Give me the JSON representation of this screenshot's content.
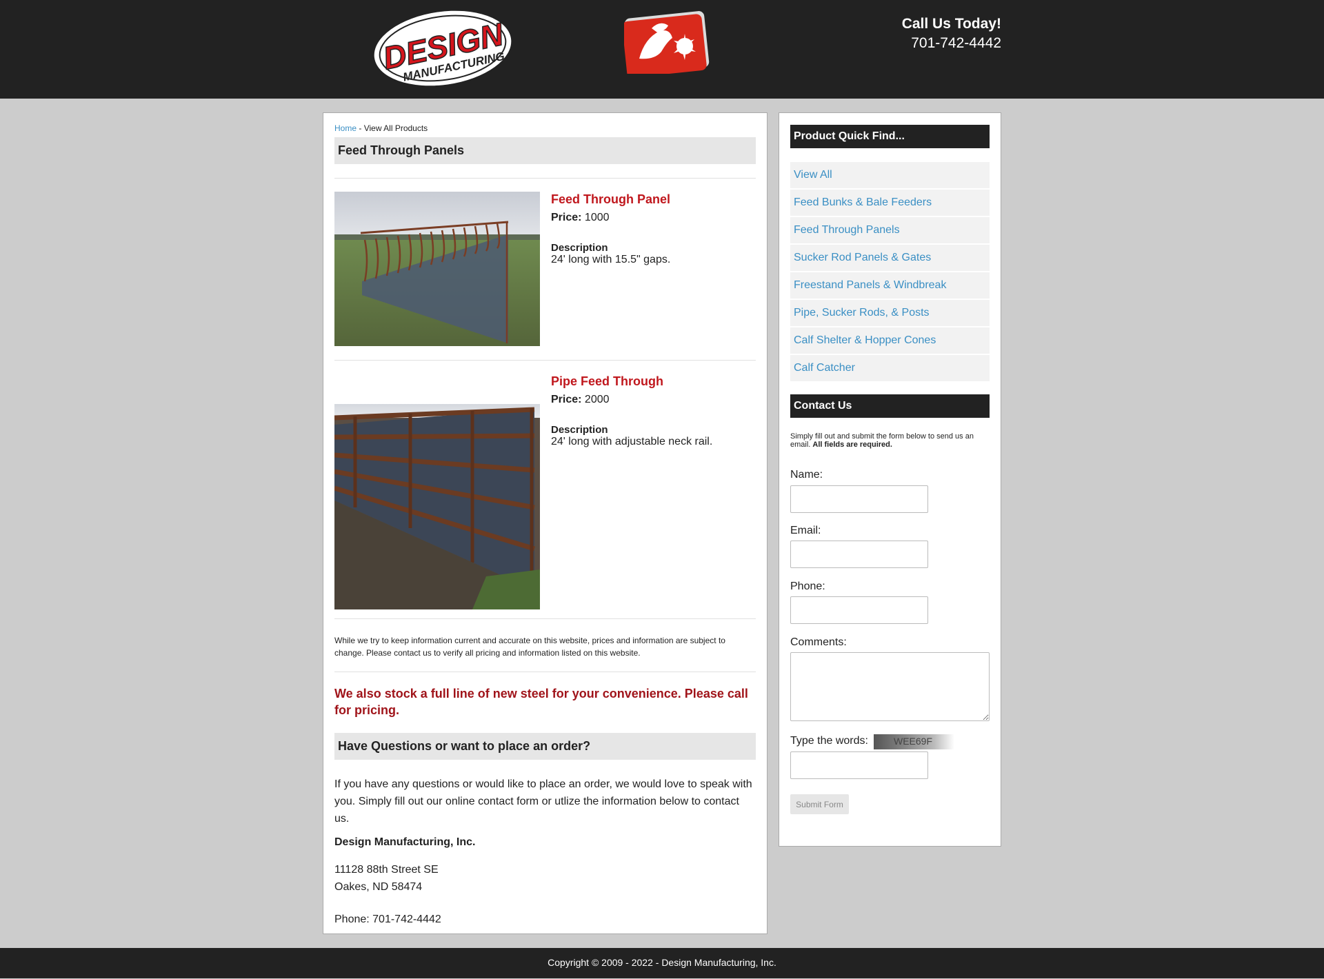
{
  "header": {
    "call_title": "Call Us Today!",
    "call_phone": "701-742-4442",
    "logo_text_1": "DESIGN",
    "logo_text_2": "MANUFACTURING"
  },
  "breadcrumb": {
    "home": "Home",
    "separator": " - ",
    "current": "View All Products"
  },
  "page_title": "Feed Through Panels",
  "products": [
    {
      "name": "Feed Through Panel",
      "price_label": "Price:",
      "price": "1000",
      "desc_label": "Description",
      "desc": "24' long with 15.5\" gaps."
    },
    {
      "name": "Pipe Feed Through",
      "price_label": "Price:",
      "price": "2000",
      "desc_label": "Description",
      "desc": "24' long with adjustable neck rail."
    }
  ],
  "disclaimer": "While we try to keep information current and accurate on this website, prices and information are subject to change. Please contact us to verify all pricing and information listed on this website.",
  "steel_notice": "We also stock a full line of new steel for your convenience. Please call for pricing.",
  "questions": {
    "title": "Have Questions or want to place an order?",
    "text": "If you have any questions or would like to place an order, we would love to speak with you. Simply fill out our online contact form or utlize the information below to contact us.",
    "company": "Design Manufacturing, Inc.",
    "address_1": "11128 88th Street SE",
    "address_2": "Oakes, ND 58474",
    "phone": "Phone: 701-742-4442"
  },
  "sidebar": {
    "quick_find_title": "Product Quick Find...",
    "items": [
      "View All",
      "Feed Bunks & Bale Feeders",
      "Feed Through Panels",
      "Sucker Rod Panels & Gates",
      "Freestand Panels & Windbreak",
      "Pipe, Sucker Rods, & Posts",
      "Calf Shelter & Hopper Cones",
      "Calf Catcher"
    ],
    "contact_title": "Contact Us",
    "contact_intro": "Simply fill out and submit the form below to send us an email.",
    "contact_intro_bold": "All fields are required.",
    "name_label": "Name:",
    "email_label": "Email:",
    "phone_label": "Phone:",
    "comments_label": "Comments:",
    "captcha_label": "Type the words:",
    "captcha_text": "WEE69F",
    "submit_label": "Submit Form"
  },
  "footer": {
    "copyright": "Copyright © 2009 - 2022 - Design Manufacturing, Inc."
  },
  "colors": {
    "header_bg": "#222222",
    "page_bg": "#cccccc",
    "accent_red": "#c0171d",
    "link_blue": "#3a8fc4"
  }
}
